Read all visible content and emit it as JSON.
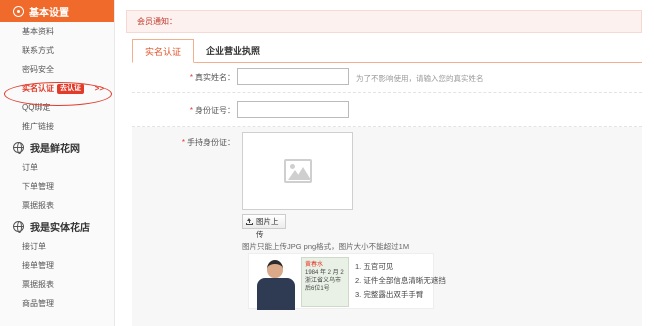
{
  "sidebar": {
    "sections": [
      {
        "title": "基本设置",
        "items": [
          "基本资料",
          "联系方式",
          "密码安全",
          "实名认证",
          "QQ绑定",
          "推广链接"
        ]
      },
      {
        "title": "我是鲜花网",
        "items": [
          "订单",
          "下单管理",
          "票据报表"
        ]
      },
      {
        "title": "我是实体花店",
        "items": [
          "接订单",
          "接单管理",
          "票据报表",
          "商品管理"
        ]
      }
    ],
    "active_badge": "去认证",
    "active_arrows": ">>"
  },
  "main": {
    "notice": "会员通知：",
    "tabs": [
      "实名认证",
      "企业营业执照"
    ],
    "form": {
      "real_name": {
        "label": "真实姓名：",
        "value": "",
        "hint": "为了不影响使用，请输入您的真实姓名"
      },
      "id_number": {
        "label": "身份证号：",
        "value": ""
      },
      "id_photo": {
        "label": "手持身份证：",
        "upload_label": "图片上传",
        "format_hint": "图片只能上传JPG png格式，图片大小不能超过1M",
        "sample_card": {
          "name": "黄春水",
          "year_line": "1984  年  2  月  2",
          "address": "浙江省义乌市",
          "extra": "后6位1号"
        },
        "tips": [
          "1. 五官可见",
          "2. 证件全部信息清晰无遮挡",
          "3. 完整露出双手手臂"
        ]
      }
    }
  }
}
